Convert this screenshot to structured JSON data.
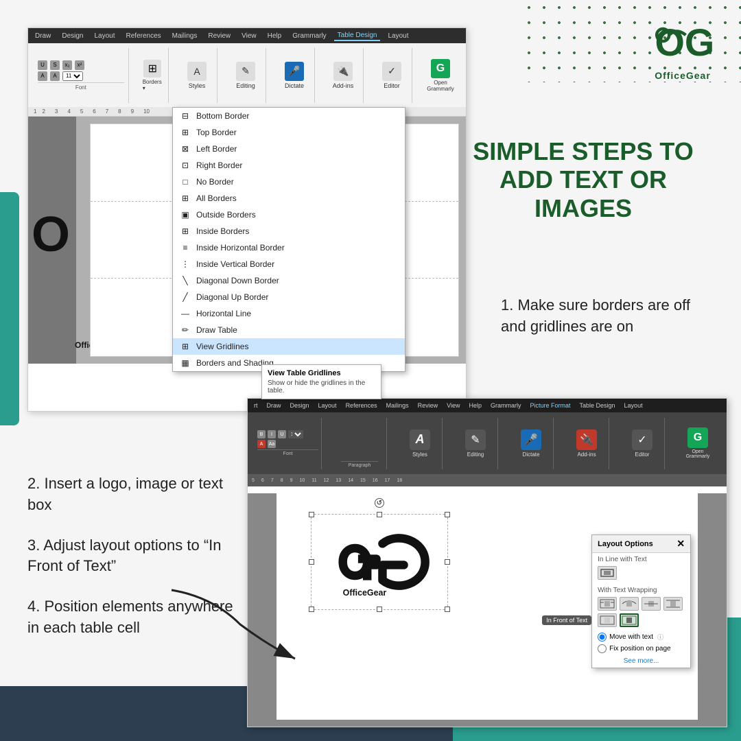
{
  "brand": {
    "name": "OfficeGear",
    "logo_text": "OfficeGear"
  },
  "title": {
    "line1": "SIMPLE STEPS TO",
    "line2": "ADD TEXT OR",
    "line3": "IMAGES"
  },
  "step1": {
    "desc": "1. Make sure borders are off and gridlines are on"
  },
  "steps": {
    "step2": "2. Insert a logo, image or text box",
    "step3": "3. Adjust layout options to “In Front of Text”",
    "step4": "4. Position elements anywhere in each table cell"
  },
  "ribbon_tabs_top": [
    "Draw",
    "Design",
    "Layout",
    "References",
    "Mailings",
    "Review",
    "View",
    "Help",
    "Grammarly",
    "Table Design",
    "Layout"
  ],
  "ribbon_buttons_top": [
    {
      "label": "Styles",
      "icon": "A"
    },
    {
      "label": "Editing",
      "icon": "✎"
    },
    {
      "label": "Dictate",
      "icon": "🎤"
    },
    {
      "label": "Add-ins",
      "icon": "🔌"
    },
    {
      "label": "Editor",
      "icon": "✓"
    },
    {
      "label": "Open Grammarly",
      "icon": "G"
    }
  ],
  "dropdown_items": [
    {
      "label": "Bottom Border",
      "icon": "⊟"
    },
    {
      "label": "Top Border",
      "icon": "⊞"
    },
    {
      "label": "Left Border",
      "icon": "⊠"
    },
    {
      "label": "Right Border",
      "icon": "⊡"
    },
    {
      "label": "No Border",
      "icon": "□"
    },
    {
      "label": "All Borders",
      "icon": "⊞"
    },
    {
      "label": "Outside Borders",
      "icon": "▣"
    },
    {
      "label": "Inside Borders",
      "icon": "⊞"
    },
    {
      "label": "Inside Horizontal Border",
      "icon": "≡"
    },
    {
      "label": "Inside Vertical Border",
      "icon": "⋮"
    },
    {
      "label": "Diagonal Down Border",
      "icon": "╲"
    },
    {
      "label": "Diagonal Up Border",
      "icon": "╱"
    },
    {
      "label": "Horizontal Line",
      "icon": "—"
    },
    {
      "label": "Draw Table",
      "icon": "✏"
    },
    {
      "label": "View Gridlines",
      "icon": "⊞",
      "highlighted": true
    },
    {
      "label": "Borders and Shading...",
      "icon": "▦"
    }
  ],
  "tooltip": {
    "title": "View Table Gridlines",
    "desc": "Show or hide the gridlines in the table."
  },
  "ribbon_tabs_bottom": [
    "rt",
    "Draw",
    "Design",
    "Layout",
    "References",
    "Mailings",
    "Review",
    "View",
    "Help",
    "Grammarly",
    "Picture Format",
    "Table Design",
    "Layout"
  ],
  "ribbon_buttons_bottom": [
    {
      "label": "Styles",
      "icon": "A"
    },
    {
      "label": "Editing",
      "icon": "✎"
    },
    {
      "label": "Dictate",
      "icon": "🎤"
    },
    {
      "label": "Add-ins",
      "icon": "🔌"
    },
    {
      "label": "Editor",
      "icon": "✓"
    },
    {
      "label": "Open Grammarly",
      "icon": "G"
    }
  ],
  "layout_options": {
    "title": "Layout Options",
    "section1": "In Line with Text",
    "section2": "With Text Wrapping",
    "radio1": "Move with text",
    "radio2": "Fix position on page",
    "see_more": "See more...",
    "in_front_badge": "In Front of Text"
  },
  "colors": {
    "green_dark": "#1a5c2a",
    "teal": "#2a9d8f",
    "dark_bg": "#2c3e50"
  }
}
